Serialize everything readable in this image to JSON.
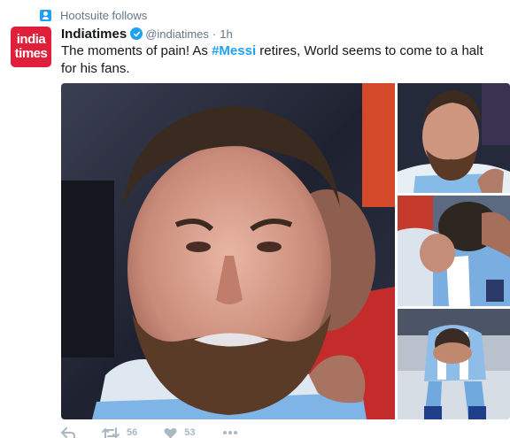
{
  "context": {
    "text": "Hootsuite follows",
    "icon": "person-icon"
  },
  "author": {
    "avatar_line1": "india",
    "avatar_line2": "times",
    "name": "Indiatimes",
    "handle": "@indiatimes",
    "separator": "·",
    "time": "1h",
    "verified": true
  },
  "tweet": {
    "text_before": "The moments of pain! As ",
    "hashtag": "#Messi",
    "text_after": " retires, World seems to come to a halt for his fans."
  },
  "media": {
    "photos": [
      "crying-player-closeup",
      "crying-player-portrait",
      "player-embraced",
      "player-seated-head-in-hands"
    ]
  },
  "actions": {
    "reply_icon": "reply-icon",
    "retweet_icon": "retweet-icon",
    "retweet_count": "56",
    "like_icon": "heart-icon",
    "like_count": "53",
    "more_icon": "more-icon"
  },
  "colors": {
    "accent": "#1da1f2",
    "avatar_bg": "#e0203a",
    "muted": "#657786",
    "action": "#aab8c2"
  }
}
